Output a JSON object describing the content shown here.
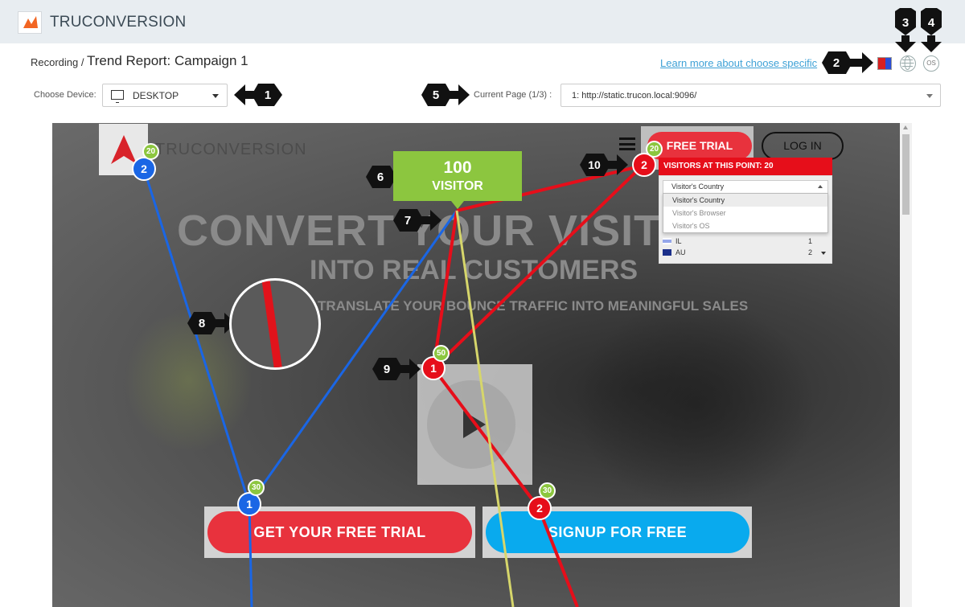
{
  "app": {
    "brand": "TRUCONVERSION"
  },
  "header": {
    "breadcrumb": "Recording /",
    "title": "Trend Report: Campaign 1",
    "learn_link": "Learn more about choose specific",
    "os_label": "OS"
  },
  "device": {
    "label": "Choose Device:",
    "value": "DESKTOP"
  },
  "page": {
    "label": "Current Page (1/3) :",
    "value": "1: http://static.trucon.local:9096/"
  },
  "site": {
    "nav": {
      "free_trial": "FREE TRIAL",
      "login": "LOG IN"
    },
    "hero": {
      "line1": "CONVERT YOUR VISITORS",
      "line2": "INTO REAL CUSTOMERS",
      "line3": "TRANSLATE YOUR BOUNCE TRAFFIC INTO MEANINGFUL SALES"
    },
    "cta_trial": "GET YOUR FREE TRIAL",
    "cta_signup": "SIGNUP FOR FREE"
  },
  "callout": {
    "count": "100",
    "label": "VISITOR"
  },
  "nodes": [
    {
      "id": "blue-top",
      "number": "2",
      "badge": "20",
      "color": "#1a66e5"
    },
    {
      "id": "blue-bottom",
      "number": "1",
      "badge": "30",
      "color": "#1a66e5"
    },
    {
      "id": "red-mid",
      "number": "1",
      "badge": "50",
      "color": "#e60e1a"
    },
    {
      "id": "red-top",
      "number": "2",
      "badge": "20",
      "color": "#e60e1a"
    },
    {
      "id": "red-bottom",
      "number": "2",
      "badge": "30",
      "color": "#e60e1a"
    }
  ],
  "popup": {
    "header": "VISITORS AT THIS POINT: 20",
    "selected": "Visitor's Country",
    "options": [
      "Visitor's Country",
      "Visitor's Browser",
      "Visitor's OS"
    ],
    "rows": [
      {
        "country": "IL",
        "count": "1"
      },
      {
        "country": "AU",
        "count": "2"
      }
    ]
  },
  "annotations": [
    "1",
    "2",
    "3",
    "4",
    "5",
    "6",
    "7",
    "8",
    "9",
    "10"
  ],
  "colors": {
    "accent_red": "#e60e1a",
    "accent_blue": "#1a66e5",
    "accent_green": "#8cc63f",
    "link_blue": "#3ea1d6",
    "cta_blue": "#09aaee",
    "path_yellow": "#d6d66b"
  }
}
